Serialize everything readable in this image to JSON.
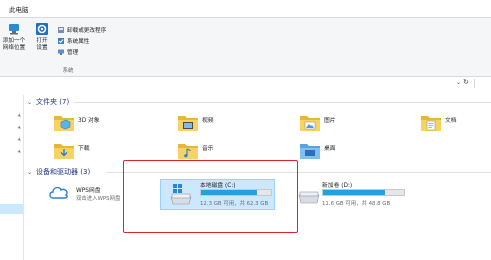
{
  "window": {
    "tab_title": "此电脑"
  },
  "ribbon": {
    "map_drive_line1": "添加一个",
    "map_drive_line2": "网络位置",
    "open_settings_line1": "打开",
    "open_settings_line2": "设置",
    "uninstall_label": "卸载或更改程序",
    "system_props_label": "系统属性",
    "manage_label": "管理",
    "group_label": "系统"
  },
  "folders_section": {
    "header": "文件夹 (7)"
  },
  "folders": [
    {
      "label": "3D 对象",
      "icon": "3d-objects-folder-icon"
    },
    {
      "label": "视频",
      "icon": "videos-folder-icon"
    },
    {
      "label": "图片",
      "icon": "pictures-folder-icon"
    },
    {
      "label": "文档",
      "icon": "documents-folder-icon"
    },
    {
      "label": "下载",
      "icon": "downloads-folder-icon"
    },
    {
      "label": "音乐",
      "icon": "music-folder-icon"
    },
    {
      "label": "桌面",
      "icon": "desktop-folder-icon"
    }
  ],
  "devices_section": {
    "header": "设备和驱动器 (3)"
  },
  "wps": {
    "name": "WPS网盘",
    "subtitle": "双击进入WPS网盘"
  },
  "drives": [
    {
      "name": "本地磁盘 (C:)",
      "free": "12.3 GB 可用，共 62.3 GB",
      "used_fraction": 0.8
    },
    {
      "name": "新加卷 (D:)",
      "free": "11.6 GB 可用，共 48.8 GB",
      "used_fraction": 0.76
    }
  ],
  "colors": {
    "accent": "#26a0da",
    "selection": "#cce8ff",
    "highlight_box": "#d9262b"
  }
}
